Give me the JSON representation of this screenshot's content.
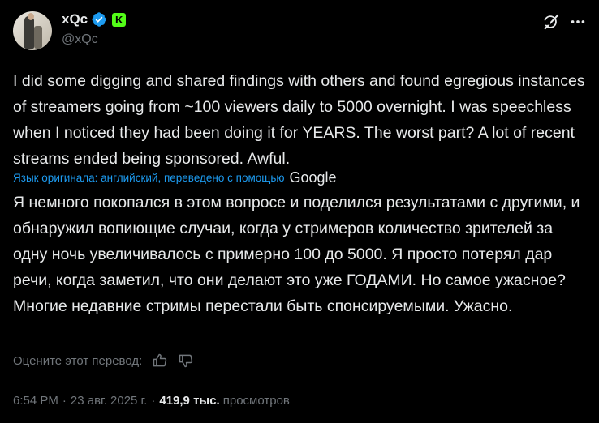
{
  "author": {
    "display_name": "xQc",
    "handle": "@xQc",
    "kick_badge": "K"
  },
  "tweet": {
    "text": "I did some digging and shared findings with others and found egregious instances of streamers going from ~100 viewers daily to 5000 overnight. I was speechless when I noticed they had been doing it for YEARS. The worst part? A lot of recent streams ended being sponsored. Awful.",
    "translation_label": "Язык оригинала: английский, переведено с помощью",
    "translation_provider": "Google",
    "translated_text": "Я немного покопался в этом вопросе и поделился результатами с другими, и обнаружил вопиющие случаи, когда у стримеров количество зрителей за одну ночь увеличивалось с примерно 100 до 5000. Я просто потерял дар речи, когда заметил, что они делают это уже ГОДАМИ. Но самое ужасное? Многие недавние стримы перестали быть спонсируемыми. Ужасно.",
    "rate_label": "Оцените этот перевод:"
  },
  "meta": {
    "time": "6:54 PM",
    "date": "23 авг. 2025 г.",
    "separator": "·",
    "views_count": "419,9 тыс.",
    "views_label": "просмотров"
  },
  "colors": {
    "background": "#000000",
    "text": "#e7e9ea",
    "secondary": "#71767b",
    "link": "#1d9bf0",
    "verified": "#1d9bf0",
    "kick": "#53fc18"
  },
  "icons": {
    "verified": "verified-badge-icon",
    "kick": "kick-badge-icon",
    "grok": "grok-icon",
    "more": "more-options-icon",
    "thumbs_up": "thumbs-up-icon",
    "thumbs_down": "thumbs-down-icon"
  }
}
